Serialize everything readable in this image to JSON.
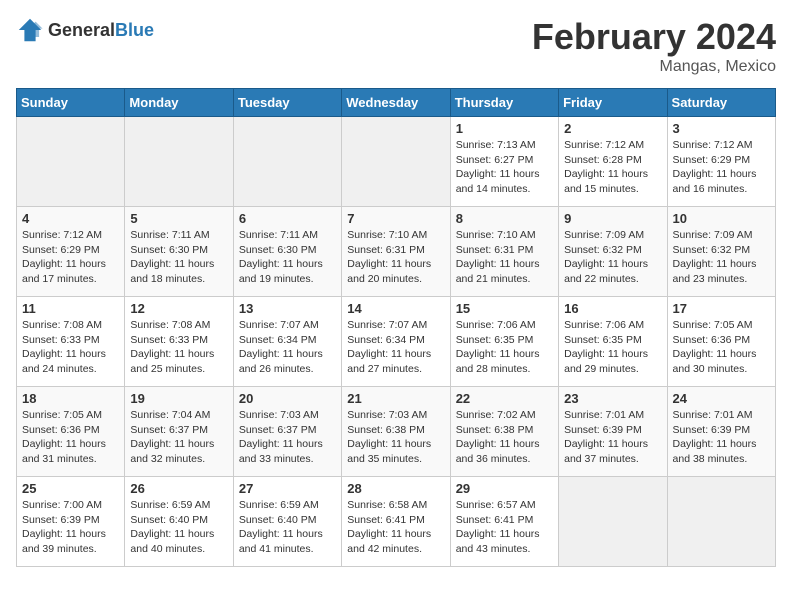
{
  "logo": {
    "general": "General",
    "blue": "Blue"
  },
  "title": "February 2024",
  "subtitle": "Mangas, Mexico",
  "weekdays": [
    "Sunday",
    "Monday",
    "Tuesday",
    "Wednesday",
    "Thursday",
    "Friday",
    "Saturday"
  ],
  "weeks": [
    [
      {
        "day": "",
        "info": ""
      },
      {
        "day": "",
        "info": ""
      },
      {
        "day": "",
        "info": ""
      },
      {
        "day": "",
        "info": ""
      },
      {
        "day": "1",
        "info": "Sunrise: 7:13 AM\nSunset: 6:27 PM\nDaylight: 11 hours\nand 14 minutes."
      },
      {
        "day": "2",
        "info": "Sunrise: 7:12 AM\nSunset: 6:28 PM\nDaylight: 11 hours\nand 15 minutes."
      },
      {
        "day": "3",
        "info": "Sunrise: 7:12 AM\nSunset: 6:29 PM\nDaylight: 11 hours\nand 16 minutes."
      }
    ],
    [
      {
        "day": "4",
        "info": "Sunrise: 7:12 AM\nSunset: 6:29 PM\nDaylight: 11 hours\nand 17 minutes."
      },
      {
        "day": "5",
        "info": "Sunrise: 7:11 AM\nSunset: 6:30 PM\nDaylight: 11 hours\nand 18 minutes."
      },
      {
        "day": "6",
        "info": "Sunrise: 7:11 AM\nSunset: 6:30 PM\nDaylight: 11 hours\nand 19 minutes."
      },
      {
        "day": "7",
        "info": "Sunrise: 7:10 AM\nSunset: 6:31 PM\nDaylight: 11 hours\nand 20 minutes."
      },
      {
        "day": "8",
        "info": "Sunrise: 7:10 AM\nSunset: 6:31 PM\nDaylight: 11 hours\nand 21 minutes."
      },
      {
        "day": "9",
        "info": "Sunrise: 7:09 AM\nSunset: 6:32 PM\nDaylight: 11 hours\nand 22 minutes."
      },
      {
        "day": "10",
        "info": "Sunrise: 7:09 AM\nSunset: 6:32 PM\nDaylight: 11 hours\nand 23 minutes."
      }
    ],
    [
      {
        "day": "11",
        "info": "Sunrise: 7:08 AM\nSunset: 6:33 PM\nDaylight: 11 hours\nand 24 minutes."
      },
      {
        "day": "12",
        "info": "Sunrise: 7:08 AM\nSunset: 6:33 PM\nDaylight: 11 hours\nand 25 minutes."
      },
      {
        "day": "13",
        "info": "Sunrise: 7:07 AM\nSunset: 6:34 PM\nDaylight: 11 hours\nand 26 minutes."
      },
      {
        "day": "14",
        "info": "Sunrise: 7:07 AM\nSunset: 6:34 PM\nDaylight: 11 hours\nand 27 minutes."
      },
      {
        "day": "15",
        "info": "Sunrise: 7:06 AM\nSunset: 6:35 PM\nDaylight: 11 hours\nand 28 minutes."
      },
      {
        "day": "16",
        "info": "Sunrise: 7:06 AM\nSunset: 6:35 PM\nDaylight: 11 hours\nand 29 minutes."
      },
      {
        "day": "17",
        "info": "Sunrise: 7:05 AM\nSunset: 6:36 PM\nDaylight: 11 hours\nand 30 minutes."
      }
    ],
    [
      {
        "day": "18",
        "info": "Sunrise: 7:05 AM\nSunset: 6:36 PM\nDaylight: 11 hours\nand 31 minutes."
      },
      {
        "day": "19",
        "info": "Sunrise: 7:04 AM\nSunset: 6:37 PM\nDaylight: 11 hours\nand 32 minutes."
      },
      {
        "day": "20",
        "info": "Sunrise: 7:03 AM\nSunset: 6:37 PM\nDaylight: 11 hours\nand 33 minutes."
      },
      {
        "day": "21",
        "info": "Sunrise: 7:03 AM\nSunset: 6:38 PM\nDaylight: 11 hours\nand 35 minutes."
      },
      {
        "day": "22",
        "info": "Sunrise: 7:02 AM\nSunset: 6:38 PM\nDaylight: 11 hours\nand 36 minutes."
      },
      {
        "day": "23",
        "info": "Sunrise: 7:01 AM\nSunset: 6:39 PM\nDaylight: 11 hours\nand 37 minutes."
      },
      {
        "day": "24",
        "info": "Sunrise: 7:01 AM\nSunset: 6:39 PM\nDaylight: 11 hours\nand 38 minutes."
      }
    ],
    [
      {
        "day": "25",
        "info": "Sunrise: 7:00 AM\nSunset: 6:39 PM\nDaylight: 11 hours\nand 39 minutes."
      },
      {
        "day": "26",
        "info": "Sunrise: 6:59 AM\nSunset: 6:40 PM\nDaylight: 11 hours\nand 40 minutes."
      },
      {
        "day": "27",
        "info": "Sunrise: 6:59 AM\nSunset: 6:40 PM\nDaylight: 11 hours\nand 41 minutes."
      },
      {
        "day": "28",
        "info": "Sunrise: 6:58 AM\nSunset: 6:41 PM\nDaylight: 11 hours\nand 42 minutes."
      },
      {
        "day": "29",
        "info": "Sunrise: 6:57 AM\nSunset: 6:41 PM\nDaylight: 11 hours\nand 43 minutes."
      },
      {
        "day": "",
        "info": ""
      },
      {
        "day": "",
        "info": ""
      }
    ]
  ]
}
